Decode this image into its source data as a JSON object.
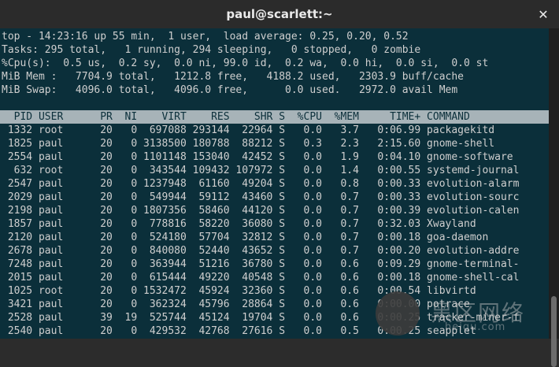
{
  "window": {
    "title": "paul@scarlett:~"
  },
  "top_summary": [
    "top - 14:23:16 up 55 min,  1 user,  load average: 0.25, 0.20, 0.52",
    "Tasks: 295 total,   1 running, 294 sleeping,   0 stopped,   0 zombie",
    "%Cpu(s):  0.5 us,  0.2 sy,  0.0 ni, 99.0 id,  0.2 wa,  0.0 hi,  0.0 si,  0.0 st",
    "MiB Mem :   7704.9 total,   1212.8 free,   4188.2 used,   2303.9 buff/cache",
    "MiB Swap:   4096.0 total,   4096.0 free,      0.0 used.   2972.0 avail Mem"
  ],
  "table": {
    "header": "  PID USER      PR  NI    VIRT    RES    SHR S  %CPU  %MEM     TIME+ COMMAND",
    "rows": [
      " 1332 root      20   0  697088 293144  22964 S   0.0   3.7   0:06.99 packagekitd",
      " 1825 paul      20   0 3138500 180788  88212 S   0.3   2.3   2:15.60 gnome-shell",
      " 2554 paul      20   0 1101148 153040  42452 S   0.0   1.9   0:04.10 gnome-software",
      "  632 root      20   0  343544 109432 107972 S   0.0   1.4   0:00.55 systemd-journal",
      " 2547 paul      20   0 1237948  61160  49204 S   0.0   0.8   0:00.33 evolution-alarm",
      " 2029 paul      20   0  549944  59112  43460 S   0.0   0.7   0:00.33 evolution-sourc",
      " 2198 paul      20   0 1807356  58460  44120 S   0.0   0.7   0:00.39 evolution-calen",
      " 1857 paul      20   0  778816  58220  36080 S   0.0   0.7   0:32.03 Xwayland",
      " 2120 paul      20   0  524180  57704  32812 S   0.0   0.7   0:00.18 goa-daemon",
      " 2678 paul      20   0  840080  52440  43652 S   0.0   0.7   0:00.20 evolution-addre",
      " 7248 paul      20   0  363944  51216  36780 S   0.0   0.6   0:09.29 gnome-terminal-",
      " 2015 paul      20   0  615444  49220  40548 S   0.0   0.6   0:00.18 gnome-shell-cal",
      " 1025 root      20   0 1532472  45924  32360 S   0.0   0.6   0:00.54 libvirtd",
      " 3421 paul      20   0  362324  45796  28864 S   0.0   0.6   0:00.00 potrace",
      " 2528 paul      39  19  525744  45124  19704 S   0.0   0.6   0:00.25 tracker-miner-f",
      " 2540 paul      20   0  429532  42768  27616 S   0.0   0.5   0:00.25 seapplet"
    ]
  },
  "watermark": {
    "text": "黑区网络",
    "sub": "heiqu.com"
  }
}
